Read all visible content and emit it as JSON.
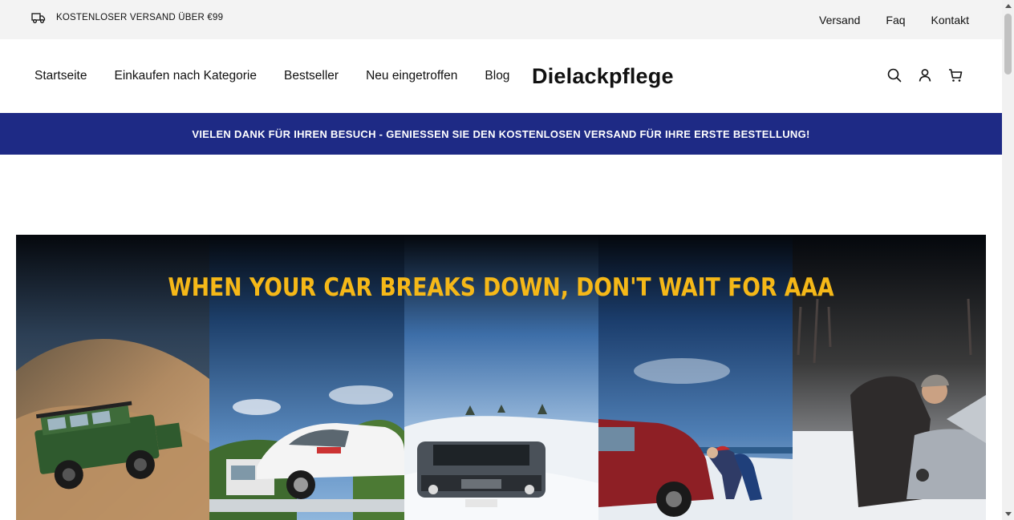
{
  "topbar": {
    "shipping_text": "KOSTENLOSER VERSAND ÜBER €99",
    "links": [
      "Versand",
      "Faq",
      "Kontakt"
    ]
  },
  "header": {
    "nav": [
      "Startseite",
      "Einkaufen nach Kategorie",
      "Bestseller",
      "Neu eingetroffen",
      "Blog"
    ],
    "logo": "Dielackpflege",
    "icons": [
      "search-icon",
      "account-icon",
      "cart-icon"
    ]
  },
  "promo": {
    "text": "VIELEN DANK FÜR IHREN BESUCH - GENIESSEN SIE DEN KOSTENLOSEN VERSAND FÜR IHRE ERSTE BESTELLUNG!",
    "background": "#1e2a85"
  },
  "hero": {
    "title": "WHEN YOUR CAR BREAKS DOWN, DON'T WAIT FOR AAA",
    "title_color": "#f5b818"
  }
}
